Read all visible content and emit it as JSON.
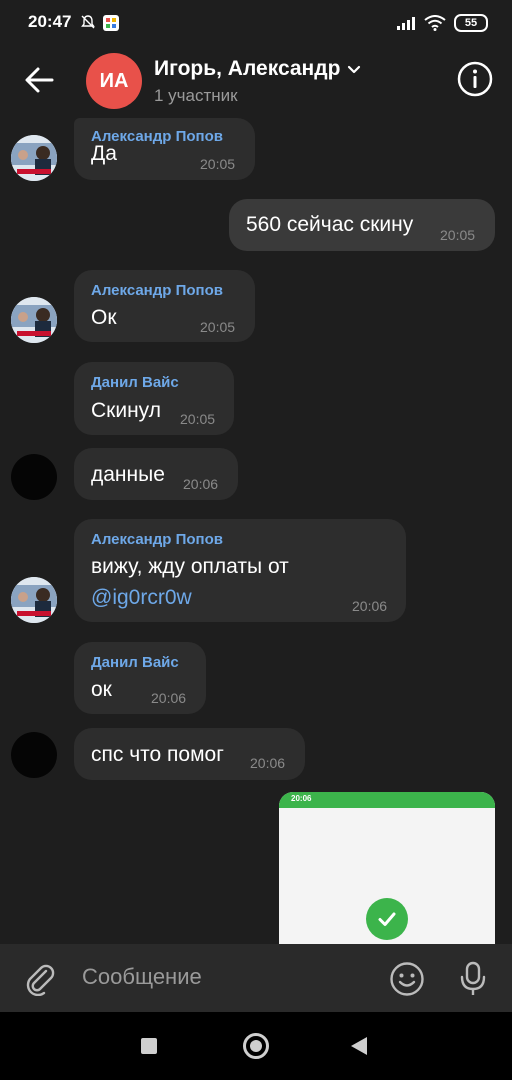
{
  "status": {
    "time": "20:47",
    "battery": "55"
  },
  "header": {
    "avatar_initials": "ИА",
    "title": "Игорь, Александр",
    "subtitle": "1 участник"
  },
  "messages": [
    {
      "sender": "Александр Попов",
      "text": "Да",
      "time": "20:05"
    },
    {
      "text": "560 сейчас скину",
      "time": "20:05"
    },
    {
      "sender": "Александр Попов",
      "text": "Ок",
      "time": "20:05"
    },
    {
      "sender": "Данил Вайс",
      "text": "Скинул",
      "time": "20:05"
    },
    {
      "text": "данные",
      "time": "20:06"
    },
    {
      "sender": "Александр Попов",
      "text_line1": "вижу, жду оплаты от",
      "mention": "@ig0rcr0w",
      "time": "20:06"
    },
    {
      "sender": "Данил Вайс",
      "text": "ок",
      "time": "20:06"
    },
    {
      "text": "спс что помог",
      "time": "20:06"
    }
  ],
  "image_message": {
    "status_time": "20:06"
  },
  "composer": {
    "placeholder": "Сообщение"
  },
  "icons": {
    "back": "arrow-left-icon",
    "info": "info-icon",
    "attach": "paperclip-icon",
    "emoji": "smile-icon",
    "mic": "microphone-icon"
  }
}
